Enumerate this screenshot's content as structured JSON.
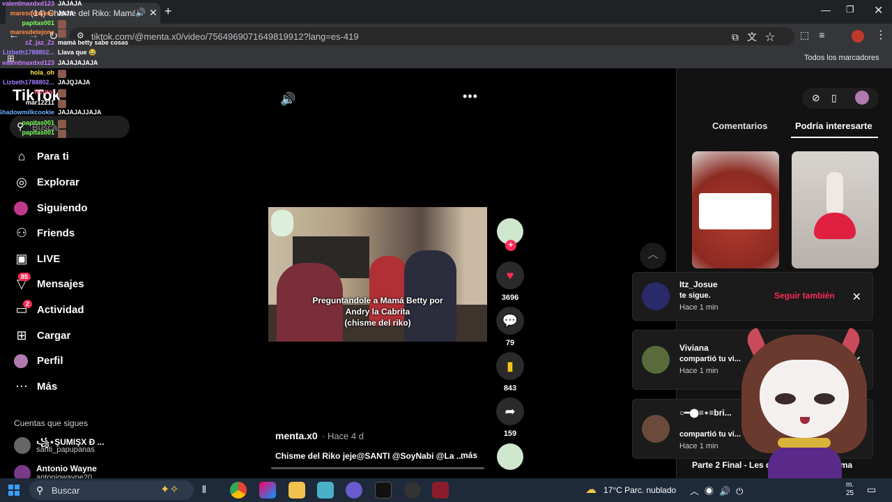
{
  "browser": {
    "tab_title": "(14) Chisme del Riko: Mamá",
    "new_tab": "+",
    "url": "tiktok.com/@menta.x0/video/7564969071649819912?lang=es-419",
    "all_bookmarks": "Todos los marcadores"
  },
  "sidebar": {
    "logo": "TikTok",
    "search_placeholder": "Buscar",
    "nav": [
      {
        "label": "Para ti",
        "icon": "home-icon"
      },
      {
        "label": "Explorar",
        "icon": "compass-icon"
      },
      {
        "label": "Siguiendo",
        "icon": "following-avatar-icon"
      },
      {
        "label": "Friends",
        "icon": "friends-icon"
      },
      {
        "label": "LIVE",
        "icon": "live-icon"
      },
      {
        "label": "Mensajes",
        "icon": "messages-icon",
        "badge": "85"
      },
      {
        "label": "Actividad",
        "icon": "activity-icon",
        "badge": "2"
      },
      {
        "label": "Cargar",
        "icon": "upload-icon"
      },
      {
        "label": "Perfil",
        "icon": "profile-avatar-icon"
      },
      {
        "label": "Más",
        "icon": "more-icon"
      }
    ],
    "following_title": "Cuentas que sigues",
    "following": [
      {
        "name": "꧁⋆ŞUMIŞX Đ ...",
        "handle": "santi_papupanas"
      },
      {
        "name": "Antonio Wayne",
        "handle": "antoniowayne20"
      }
    ]
  },
  "video": {
    "caption_line1": "Preguntandole a Mamá Betty por",
    "caption_line2": "Andry la Cabrita",
    "caption_line3": "(chisme del riko)",
    "author": "menta.x0",
    "time": "· Hace 4 d",
    "description": "Chisme del Riko jeje@SANTI @SoyNabi @La ...",
    "more": "más",
    "likes": "3696",
    "comments": "79",
    "saves": "843",
    "shares": "159"
  },
  "right_panel": {
    "tab_comments": "Comentarios",
    "tab_interest": "Podría interesarte",
    "bottom_title": "Parte 2 Final - Les dije a mis papás tema"
  },
  "notifications": [
    {
      "name": "Itz_Josue",
      "text": "te sigue.",
      "time": "Hace 1 min",
      "action": "Seguir también"
    },
    {
      "name": "Viviana",
      "text": "compartió tu vi...",
      "time": "Hace 1 min"
    },
    {
      "name": "○━⬤≡⋆≡bri...",
      "text": "compartió tu vi...",
      "time": "Hace 1 min"
    }
  ],
  "chat": [
    {
      "user": "valentinaxdxd123",
      "msg": "JAJAJA",
      "color": "#c77dff"
    },
    {
      "user": "maresdetejone",
      "msg": "JAJA",
      "color": "#ff8c42"
    },
    {
      "user": "papitas001",
      "msg": "",
      "color": "#7cff5a"
    },
    {
      "user": "maresdetejone",
      "msg": "",
      "color": "#ff8c42"
    },
    {
      "user": "zZ_jaz_Zz",
      "msg": "mamá betty sabe cosas",
      "color": "#c77dff"
    },
    {
      "user": "Lizbeth1788802...",
      "msg": "Llava que 😂",
      "color": "#a080ff"
    },
    {
      "user": "valentinaxdxd123",
      "msg": "JAJAJAJAJA",
      "color": "#c77dff"
    },
    {
      "user": "hola_oh",
      "msg": "",
      "color": "#ffe14d"
    },
    {
      "user": "Lizbeth1788802...",
      "msg": "JAJQJAJA",
      "color": "#a080ff"
    },
    {
      "user": "Neritol",
      "msg": "",
      "color": "#ff6f91"
    },
    {
      "user": "mar12211",
      "msg": "",
      "color": "#ffffff"
    },
    {
      "user": "Shadowmilkcookie",
      "msg": "JAJAJAJJAJA",
      "color": "#6fb1ff"
    },
    {
      "user": "papitas001",
      "msg": "",
      "color": "#7cff5a"
    },
    {
      "user": "papitas001",
      "msg": "",
      "color": "#7cff5a"
    }
  ],
  "taskbar": {
    "search": "Buscar",
    "weather": "17°C  Parc. nublado",
    "clock_line1": "m.",
    "clock_line2": "25"
  }
}
